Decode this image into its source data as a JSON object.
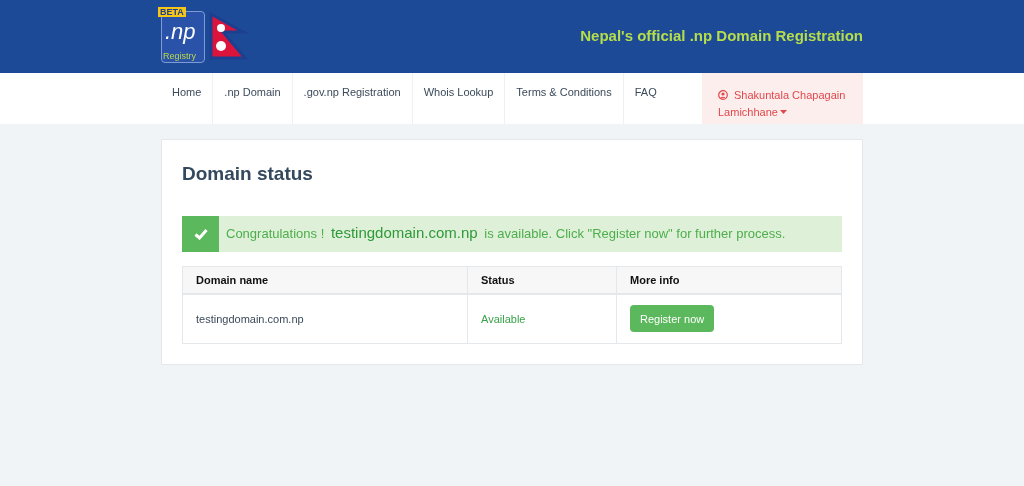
{
  "header": {
    "logo": {
      "badge": "BETA",
      "mark": ".np",
      "caption": "Registry"
    },
    "tagline": "Nepal's official .np Domain Registration"
  },
  "nav": {
    "items": [
      {
        "label": "Home"
      },
      {
        "label": ".np Domain"
      },
      {
        "label": ".gov.np Registration"
      },
      {
        "label": "Whois Lookup"
      },
      {
        "label": "Terms & Conditions"
      },
      {
        "label": "FAQ"
      }
    ],
    "user": {
      "name": "Shakuntala Chapagain Lamichhane"
    }
  },
  "card": {
    "title": "Domain status",
    "alert": {
      "prefix": "Congratulations !",
      "domain": "testingdomain.com.np",
      "suffix": "is available. Click \"Register now\" for further process."
    },
    "table": {
      "columns": [
        "Domain name",
        "Status",
        "More info"
      ],
      "rows": [
        {
          "domain": "testingdomain.com.np",
          "status": "Available",
          "action": "Register now"
        }
      ]
    }
  }
}
